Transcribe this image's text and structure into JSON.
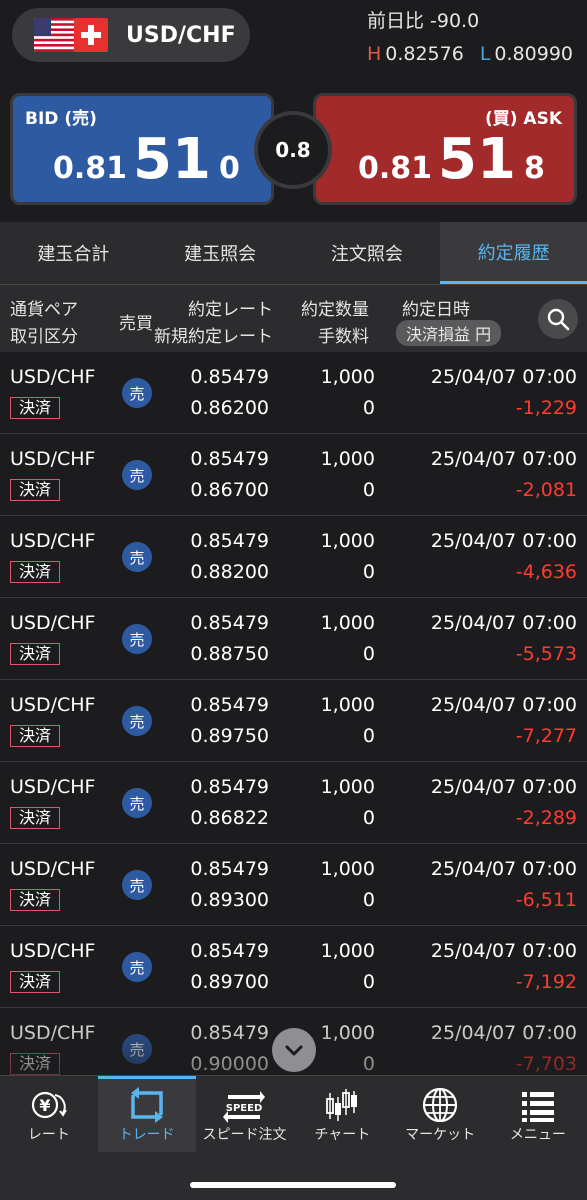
{
  "header": {
    "pair": "USD/CHF",
    "change_label": "前日比",
    "change_value": "-90.0",
    "high_label": "H",
    "high_value": "0.82576",
    "low_label": "L",
    "low_value": "0.80990"
  },
  "quote": {
    "bid_label": "BID (売)",
    "bid_prefix": "0.81",
    "bid_big": "51",
    "bid_suffix": "0",
    "ask_label": "(買) ASK",
    "ask_prefix": "0.81",
    "ask_big": "51",
    "ask_suffix": "8",
    "spread": "0.8"
  },
  "tabs": [
    {
      "label": "建玉合計"
    },
    {
      "label": "建玉照会"
    },
    {
      "label": "注文照会"
    },
    {
      "label": "約定履歴"
    }
  ],
  "columns": {
    "pair": "通貨ペア",
    "kind": "取引区分",
    "side": "売買",
    "rate": "約定レート",
    "new_rate": "新規約定レート",
    "qty": "約定数量",
    "fee": "手数料",
    "datetime": "約定日時",
    "pl": "決済損益 円"
  },
  "rows": [
    {
      "pair": "USD/CHF",
      "kind": "決済",
      "side": "売",
      "rate": "0.85479",
      "new_rate": "0.86200",
      "qty": "1,000",
      "fee": "0",
      "datetime": "25/04/07 07:00",
      "pl": "-1,229"
    },
    {
      "pair": "USD/CHF",
      "kind": "決済",
      "side": "売",
      "rate": "0.85479",
      "new_rate": "0.86700",
      "qty": "1,000",
      "fee": "0",
      "datetime": "25/04/07 07:00",
      "pl": "-2,081"
    },
    {
      "pair": "USD/CHF",
      "kind": "決済",
      "side": "売",
      "rate": "0.85479",
      "new_rate": "0.88200",
      "qty": "1,000",
      "fee": "0",
      "datetime": "25/04/07 07:00",
      "pl": "-4,636"
    },
    {
      "pair": "USD/CHF",
      "kind": "決済",
      "side": "売",
      "rate": "0.85479",
      "new_rate": "0.88750",
      "qty": "1,000",
      "fee": "0",
      "datetime": "25/04/07 07:00",
      "pl": "-5,573"
    },
    {
      "pair": "USD/CHF",
      "kind": "決済",
      "side": "売",
      "rate": "0.85479",
      "new_rate": "0.89750",
      "qty": "1,000",
      "fee": "0",
      "datetime": "25/04/07 07:00",
      "pl": "-7,277"
    },
    {
      "pair": "USD/CHF",
      "kind": "決済",
      "side": "売",
      "rate": "0.85479",
      "new_rate": "0.86822",
      "qty": "1,000",
      "fee": "0",
      "datetime": "25/04/07 07:00",
      "pl": "-2,289"
    },
    {
      "pair": "USD/CHF",
      "kind": "決済",
      "side": "売",
      "rate": "0.85479",
      "new_rate": "0.89300",
      "qty": "1,000",
      "fee": "0",
      "datetime": "25/04/07 07:00",
      "pl": "-6,511"
    },
    {
      "pair": "USD/CHF",
      "kind": "決済",
      "side": "売",
      "rate": "0.85479",
      "new_rate": "0.89700",
      "qty": "1,000",
      "fee": "0",
      "datetime": "25/04/07 07:00",
      "pl": "-7,192"
    },
    {
      "pair": "USD/CHF",
      "kind": "決済",
      "side": "売",
      "rate": "0.85479",
      "new_rate": "0.90000",
      "qty": "1,000",
      "fee": "0",
      "datetime": "25/04/07 07:00",
      "pl": "-7,703"
    }
  ],
  "nav": [
    {
      "label": "レート",
      "icon": "rate-icon"
    },
    {
      "label": "トレード",
      "icon": "trade-icon"
    },
    {
      "label": "スピード注文",
      "icon": "speed-icon",
      "icon_text": "SPEED"
    },
    {
      "label": "チャート",
      "icon": "chart-icon"
    },
    {
      "label": "マーケット",
      "icon": "globe-icon"
    },
    {
      "label": "メニュー",
      "icon": "menu-icon"
    }
  ],
  "colors": {
    "bid": "#2d5aa0",
    "ask": "#a32a2a",
    "accent": "#5ab4ee",
    "loss": "#ff3b30"
  }
}
